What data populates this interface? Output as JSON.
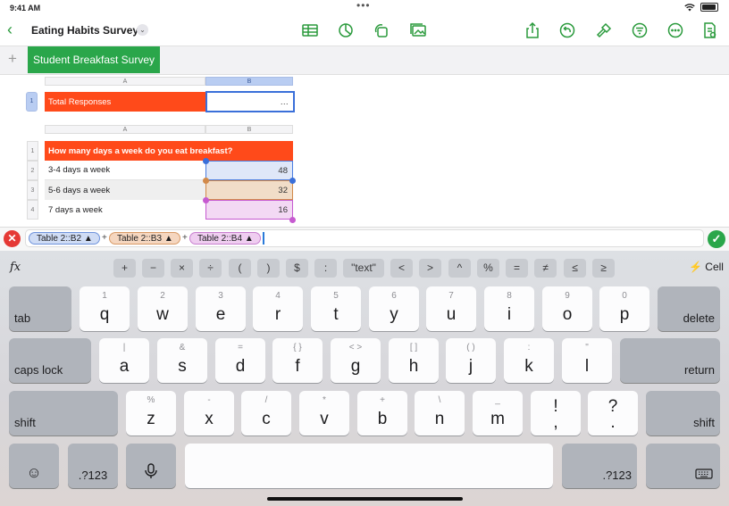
{
  "status": {
    "time": "9:41 AM",
    "dots": "•••"
  },
  "toolbar": {
    "back": "‹",
    "doc_title": "Eating Habits Survey",
    "title_chevron": "⌄"
  },
  "tabs": {
    "add": "+",
    "active": "Student Breakfast Survey"
  },
  "table1": {
    "columns": [
      "A",
      "B"
    ],
    "row_number": "1",
    "label": "Total Responses",
    "value": "…",
    "accent": "#ff4a1a"
  },
  "table2": {
    "columns": [
      "A",
      "B"
    ],
    "header": "How many days a week do you eat breakfast?",
    "rows": [
      {
        "num": "1"
      },
      {
        "num": "2",
        "label": "3-4 days a week",
        "value": "48"
      },
      {
        "num": "3",
        "label": "5-6 days a week",
        "value": "32"
      },
      {
        "num": "4",
        "label": "7 days a week",
        "value": "16"
      }
    ]
  },
  "formula": {
    "cancel": "✕",
    "confirm": "✓",
    "tokens": [
      "Table 2::B2 ▲",
      "Table 2::B3 ▲",
      "Table 2::B4 ▲"
    ],
    "operators": [
      "+",
      "+"
    ],
    "token_colors": [
      "#cfdcf5",
      "#f5d6bf",
      "#efcdf0"
    ]
  },
  "keyboard": {
    "fx": "fx",
    "ops": [
      "+",
      "−",
      "×",
      "÷",
      "(",
      ")",
      "$",
      ":",
      "\"text\"",
      "<",
      ">",
      "^",
      "%",
      "=",
      "≠",
      "≤",
      "≥"
    ],
    "cell": "⚡ Cell",
    "row1": [
      {
        "hint": "1",
        "key": "q"
      },
      {
        "hint": "2",
        "key": "w"
      },
      {
        "hint": "3",
        "key": "e"
      },
      {
        "hint": "4",
        "key": "r"
      },
      {
        "hint": "5",
        "key": "t"
      },
      {
        "hint": "6",
        "key": "y"
      },
      {
        "hint": "7",
        "key": "u"
      },
      {
        "hint": "8",
        "key": "i"
      },
      {
        "hint": "9",
        "key": "o"
      },
      {
        "hint": "0",
        "key": "p"
      }
    ],
    "row2": [
      {
        "hint": "|",
        "key": "a"
      },
      {
        "hint": "&",
        "key": "s"
      },
      {
        "hint": "=",
        "key": "d"
      },
      {
        "hint": "{  }",
        "key": "f"
      },
      {
        "hint": "<  >",
        "key": "g"
      },
      {
        "hint": "[  ]",
        "key": "h"
      },
      {
        "hint": "(  )",
        "key": "j"
      },
      {
        "hint": ":",
        "key": "k"
      },
      {
        "hint": "\"",
        "key": "l"
      }
    ],
    "row3": [
      {
        "hint": "%",
        "key": "z"
      },
      {
        "hint": "-",
        "key": "x"
      },
      {
        "hint": "/",
        "key": "c"
      },
      {
        "hint": "*",
        "key": "v"
      },
      {
        "hint": "+",
        "key": "b"
      },
      {
        "hint": "\\",
        "key": "n"
      },
      {
        "hint": "_",
        "key": "m"
      },
      {
        "hint": "!",
        "key": ","
      },
      {
        "hint": "?",
        "key": "."
      }
    ],
    "tab": "tab",
    "delete": "delete",
    "caps_lock": "caps lock",
    "return": "return",
    "shift": "shift",
    "numbers": ".?123",
    "emoji": "☺",
    "mic": "🎙"
  }
}
